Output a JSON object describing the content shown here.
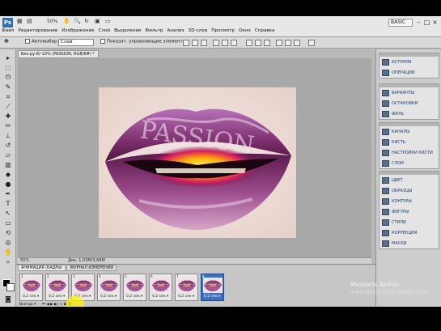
{
  "app": {
    "badge": "Ps",
    "zoom": "50%",
    "workspace": "BASIC",
    "menus": [
      "Файл",
      "Редактирование",
      "Изображение",
      "Слой",
      "Выделение",
      "Фильтр",
      "Анализ",
      "3D-слои",
      "Просмотр",
      "Окно",
      "Справка"
    ]
  },
  "options": {
    "autoselect_label": "Автовыбор:",
    "autoselect_value": "Слой",
    "transform_label": "Показат. управляющие элементы"
  },
  "document": {
    "tab_title": "Без-ру-8/-10% (PASSION, RGB/8#) *",
    "status": "50%",
    "doc_size": "Док: 1,03M/3,66M"
  },
  "panels": {
    "group1": [
      "ИСТОРИЯ",
      "ОПЕРАЦИИ"
    ],
    "group2": [
      "ВАРИАНТЫ",
      "ОСТАНОВКИ",
      "ФИЛЬ"
    ],
    "group3": [
      "КАНАЛЫ",
      "КИСТЬ",
      "НАСТРОЙКИ КИСТИ",
      "СЛОИ"
    ],
    "group4": [
      "ЦВЕТ",
      "ОБРАЗЦЫ",
      "КОНТУРЫ",
      "ФИГУРЫ",
      "СТИЛИ",
      "КОРРЕКЦИЯ",
      "МАСКИ"
    ]
  },
  "animation": {
    "tabs": [
      "АНИМАЦИЯ (КАДРЫ)",
      "ЖУРНАЛ ИЗМЕРЕНИЙ"
    ],
    "frames": [
      {
        "num": "1",
        "delay": "0,2 сек.▾"
      },
      {
        "num": "2",
        "delay": "0,2 сек.▾"
      },
      {
        "num": "3",
        "delay": "0,2 сек.▾"
      },
      {
        "num": "4",
        "delay": "0,2 сек.▾"
      },
      {
        "num": "5",
        "delay": "0,2 сек.▾"
      },
      {
        "num": "6",
        "delay": "0,2 сек.▾"
      },
      {
        "num": "7",
        "delay": "0,2 сек.▾"
      },
      {
        "num": "8",
        "delay": "0,2 сек.▾"
      }
    ],
    "selected_frame": 8,
    "loop_label": "Всегда ▾"
  },
  "watermark": {
    "line1": "Михаэль Антон",
    "line2": "www.photoshop-video.com"
  },
  "colors": {
    "accent": "#2f6fb8",
    "selected_frame": "#3b6fbf",
    "panel_text": "#1e3d6b"
  }
}
